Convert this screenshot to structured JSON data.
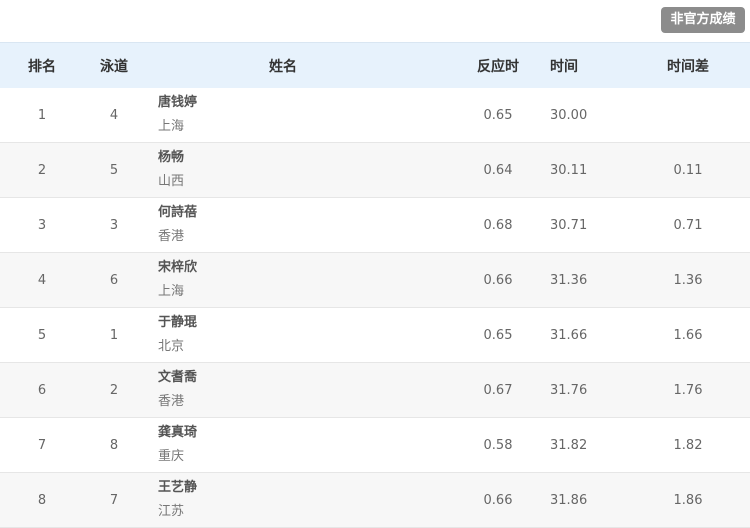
{
  "topbar": {
    "unofficial_label": "非官方成绩"
  },
  "table": {
    "headers": {
      "rank": "排名",
      "lane": "泳道",
      "name": "姓名",
      "reaction": "反应时",
      "time": "时间",
      "diff": "时间差"
    },
    "rows": [
      {
        "rank": "1",
        "lane": "4",
        "name": "唐钱婷",
        "region": "上海",
        "reaction": "0.65",
        "time": "30.00",
        "diff": ""
      },
      {
        "rank": "2",
        "lane": "5",
        "name": "杨畅",
        "region": "山西",
        "reaction": "0.64",
        "time": "30.11",
        "diff": "0.11"
      },
      {
        "rank": "3",
        "lane": "3",
        "name": "何詩蓓",
        "region": "香港",
        "reaction": "0.68",
        "time": "30.71",
        "diff": "0.71"
      },
      {
        "rank": "4",
        "lane": "6",
        "name": "宋梓欣",
        "region": "上海",
        "reaction": "0.66",
        "time": "31.36",
        "diff": "1.36"
      },
      {
        "rank": "5",
        "lane": "1",
        "name": "于静琨",
        "region": "北京",
        "reaction": "0.65",
        "time": "31.66",
        "diff": "1.66"
      },
      {
        "rank": "6",
        "lane": "2",
        "name": "文耆喬",
        "region": "香港",
        "reaction": "0.67",
        "time": "31.76",
        "diff": "1.76"
      },
      {
        "rank": "7",
        "lane": "8",
        "name": "龚真琦",
        "region": "重庆",
        "reaction": "0.58",
        "time": "31.82",
        "diff": "1.82"
      },
      {
        "rank": "8",
        "lane": "7",
        "name": "王艺静",
        "region": "江苏",
        "reaction": "0.66",
        "time": "31.86",
        "diff": "1.86"
      }
    ]
  }
}
